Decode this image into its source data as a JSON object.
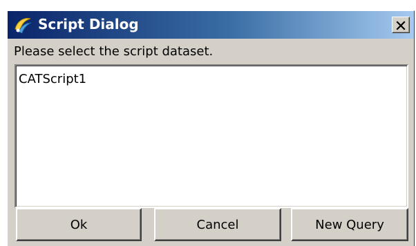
{
  "window": {
    "title": "Script Dialog",
    "app_icon": "catia-icon",
    "close_icon": "close-icon"
  },
  "prompt": "Please select the script dataset.",
  "list": {
    "items": [
      "CATScript1"
    ]
  },
  "buttons": {
    "ok": "Ok",
    "cancel": "Cancel",
    "new_query": "New Query"
  },
  "colors": {
    "titlebar_start": "#0a246a",
    "titlebar_end": "#a6caf0",
    "face": "#d4d0c8"
  }
}
